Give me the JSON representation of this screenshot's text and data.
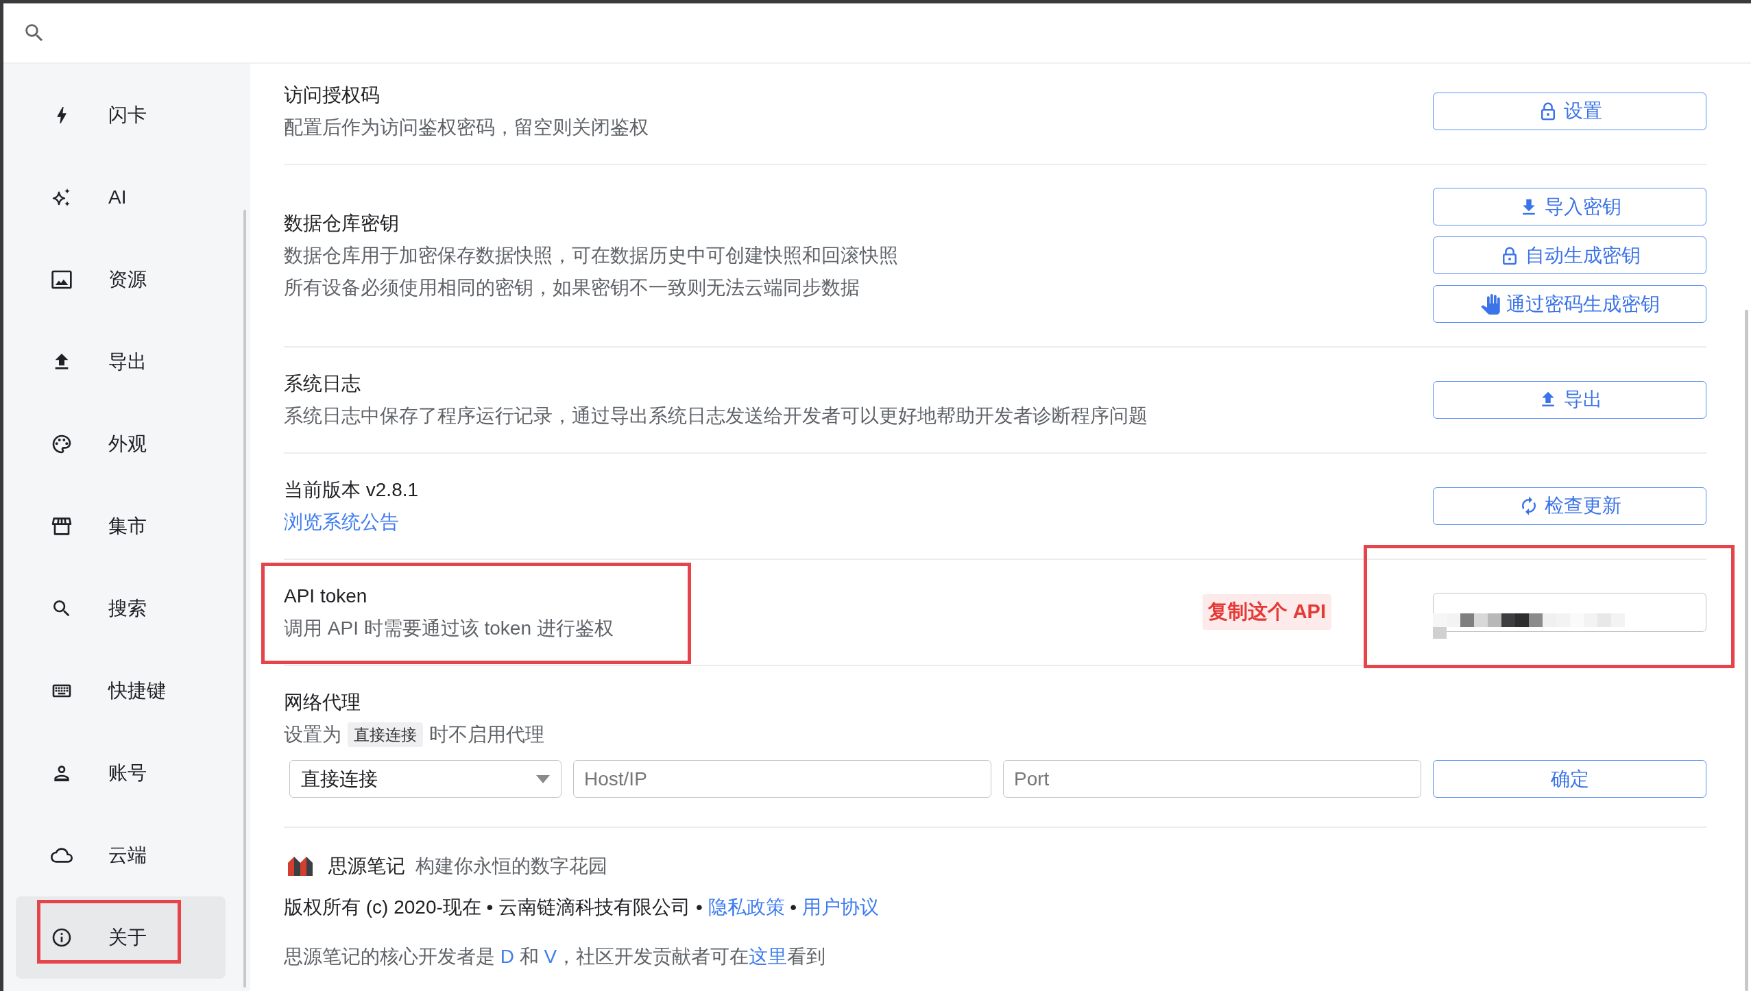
{
  "sidebar": {
    "items": [
      {
        "label": "闪卡",
        "selected": false,
        "annotated": false
      },
      {
        "label": "AI",
        "selected": false,
        "annotated": false
      },
      {
        "label": "资源",
        "selected": false,
        "annotated": false
      },
      {
        "label": "导出",
        "selected": false,
        "annotated": false
      },
      {
        "label": "外观",
        "selected": false,
        "annotated": false
      },
      {
        "label": "集市",
        "selected": false,
        "annotated": false
      },
      {
        "label": "搜索",
        "selected": false,
        "annotated": false
      },
      {
        "label": "快捷键",
        "selected": false,
        "annotated": false
      },
      {
        "label": "账号",
        "selected": false,
        "annotated": false
      },
      {
        "label": "云端",
        "selected": false,
        "annotated": false
      },
      {
        "label": "关于",
        "selected": true,
        "annotated": true
      }
    ]
  },
  "sections": [
    {
      "kind": "setting",
      "title": "访问授权码",
      "description": [
        "配置后作为访问鉴权密码，留空则关闭鉴权"
      ],
      "buttons": [
        {
          "label": "设置"
        }
      ]
    },
    {
      "kind": "setting",
      "title": "数据仓库密钥",
      "description": [
        "数据仓库用于加密保存数据快照，可在数据历史中可创建快照和回滚快照",
        "所有设备必须使用相同的密钥，如果密钥不一致则无法云端同步数据"
      ],
      "buttons": [
        {
          "label": "导入密钥"
        },
        {
          "label": "自动生成密钥"
        },
        {
          "label": "通过密码生成密钥"
        }
      ]
    },
    {
      "kind": "setting",
      "title": "系统日志",
      "description": [
        "系统日志中保存了程序运行记录，通过导出系统日志发送给开发者可以更好地帮助开发者诊断程序问题"
      ],
      "buttons": [
        {
          "label": "导出"
        }
      ]
    },
    {
      "kind": "setting",
      "title": "当前版本 v2.8.1",
      "link": "浏览系统公告",
      "buttons": [
        {
          "label": "检查更新"
        }
      ]
    },
    {
      "kind": "token",
      "title": "API token",
      "description": [
        "调用 API 时需要通过该 token 进行鉴权"
      ],
      "annotated": true,
      "callout": "复制这个 API",
      "field": {
        "redacted": true,
        "annotated": true
      }
    },
    {
      "kind": "proxy",
      "title": "网络代理",
      "description_parts": [
        {
          "kind": "text",
          "text": "设置为"
        },
        {
          "kind": "code",
          "text": "直接连接"
        },
        {
          "kind": "text",
          "text": "时不启用代理"
        }
      ],
      "mode_select": {
        "value": "直接连接"
      },
      "host_field": {
        "placeholder": "Host/IP"
      },
      "port_field": {
        "placeholder": "Port"
      },
      "confirm_button": "确定"
    },
    {
      "kind": "about",
      "brand": "思源笔记",
      "slogan": "构建你永恒的数字花园",
      "copyright": [
        {
          "kind": "text",
          "text": "版权所有 (c) 2020-现在 • 云南链滴科技有限公司 • "
        },
        {
          "kind": "link",
          "text": "隐私政策"
        },
        {
          "kind": "text",
          "text": " • "
        },
        {
          "kind": "link",
          "text": "用户协议"
        }
      ],
      "credits": [
        {
          "kind": "text",
          "text": "思源笔记的核心开发者是 "
        },
        {
          "kind": "link",
          "text": "D"
        },
        {
          "kind": "text",
          "text": " 和 "
        },
        {
          "kind": "link",
          "text": "V"
        },
        {
          "kind": "text",
          "text": "，社区开发贡献者可在"
        },
        {
          "kind": "link",
          "text": "这里"
        },
        {
          "kind": "text",
          "text": "看到"
        }
      ]
    }
  ]
}
